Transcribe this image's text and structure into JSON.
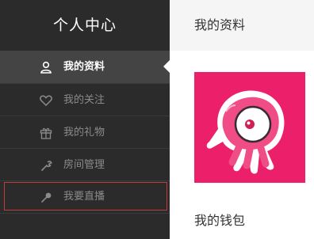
{
  "sidebar": {
    "title": "个人中心",
    "items": [
      {
        "label": "我的资料",
        "icon": "user-icon",
        "active": true
      },
      {
        "label": "我的关注",
        "icon": "heart-icon",
        "active": false
      },
      {
        "label": "我的礼物",
        "icon": "gift-icon",
        "active": false
      },
      {
        "label": "房间管理",
        "icon": "wrench-icon",
        "active": false
      },
      {
        "label": "我要直播",
        "icon": "broadcast-icon",
        "active": false
      }
    ]
  },
  "main": {
    "header_title": "我的资料",
    "wallet_title": "我的钱包"
  },
  "colors": {
    "sidebar_bg": "#2b2b2b",
    "active_item_bg": "#444444",
    "avatar_bg": "#ec1f6b",
    "highlight_border": "#c23b3b"
  }
}
